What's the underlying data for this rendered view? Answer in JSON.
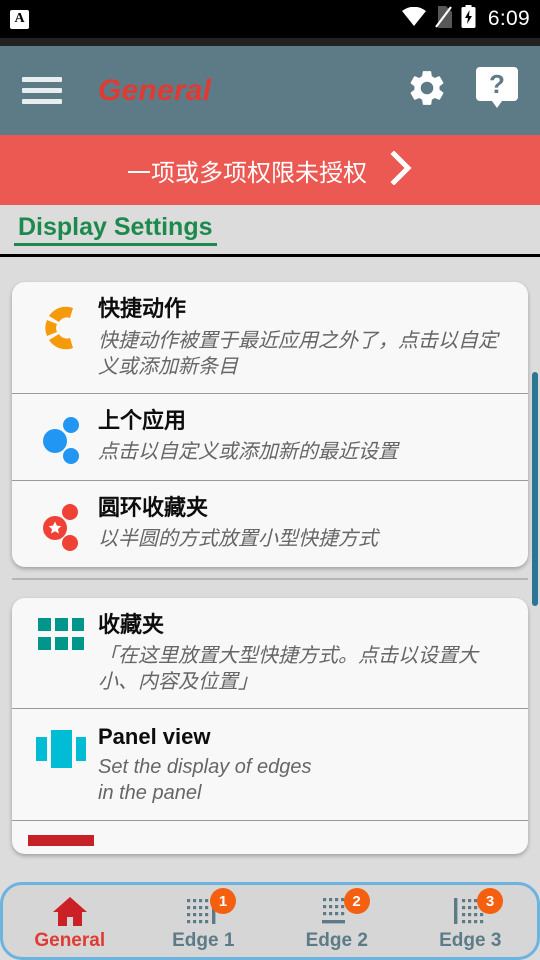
{
  "statusbar": {
    "notification_icon": "notification-a-icon",
    "wifi_icon": "wifi-icon",
    "sim_icon": "no-sim-icon",
    "battery_icon": "battery-charging-icon",
    "notification_letter": "A",
    "time": "6:09"
  },
  "toolbar": {
    "menu_icon": "hamburger-menu-icon",
    "title": "General",
    "settings_icon": "gear-icon",
    "help_icon": "help-question-icon",
    "background_color": "#5d7b87",
    "title_color": "#e03b32"
  },
  "warning_banner": {
    "text": "一项或多项权限未授权",
    "chevron_icon": "chevron-right-icon",
    "background_color": "#ec5852"
  },
  "section": {
    "title": "Display Settings",
    "color": "#1c8a4c"
  },
  "cards": [
    {
      "rows": [
        {
          "icon": "quick-action-ring-icon",
          "icon_color": "#f59b0b",
          "title": "快捷动作",
          "subtitle": "快捷动作被置于最近应用之外了，点击以自定义或添加新条目",
          "latin": false
        },
        {
          "icon": "last-app-dots-icon",
          "icon_color": "#2196f3",
          "title": "上个应用",
          "subtitle": "点击以自定义或添加新的最近设置",
          "latin": false
        },
        {
          "icon": "ring-favorites-star-icon",
          "icon_color": "#ef4136",
          "title": "圆环收藏夹",
          "subtitle": "以半圆的方式放置小型快捷方式",
          "latin": false
        }
      ]
    },
    {
      "rows": [
        {
          "icon": "favorites-grid-icon",
          "icon_color": "#00968b",
          "title": "收藏夹",
          "subtitle": "「在这里放置大型快捷方式。点击以设置大小、内容及位置」",
          "latin": false
        },
        {
          "icon": "panel-view-icon",
          "icon_color": "#00bcd4",
          "title": "Panel view",
          "subtitle": "Set the display of edges\n in the panel",
          "latin": true
        },
        {
          "icon": "bar-red-icon",
          "icon_color": "#c52127",
          "title": "",
          "subtitle": "",
          "latin": false,
          "clipped": true
        }
      ]
    }
  ],
  "scrollbar": {
    "color": "#2d7693"
  },
  "bottomnav": {
    "border_color": "#6cb3e0",
    "background_color": "#d6d6d6",
    "items": [
      {
        "label": "General",
        "icon": "home-icon",
        "badge": null,
        "active": true
      },
      {
        "label": "Edge 1",
        "icon": "edge-1-icon",
        "badge": "1",
        "active": false
      },
      {
        "label": "Edge 2",
        "icon": "edge-2-icon",
        "badge": "2",
        "active": false
      },
      {
        "label": "Edge 3",
        "icon": "edge-3-icon",
        "badge": "3",
        "active": false
      }
    ]
  }
}
